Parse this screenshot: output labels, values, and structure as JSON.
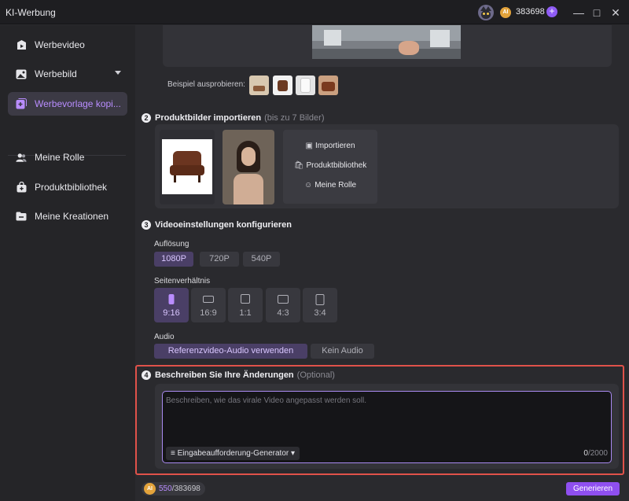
{
  "app": {
    "title": "KI-Werbung",
    "credits": "383698",
    "coin_label": "AI"
  },
  "sidebar": {
    "items": [
      {
        "label": "Werbevideo",
        "icon": "video-icon"
      },
      {
        "label": "Werbebild",
        "icon": "image-icon"
      },
      {
        "label": "Werbevorlage kopi...",
        "icon": "template-copy-icon",
        "active": true
      },
      {
        "label": "Meine Rolle",
        "icon": "user-icon"
      },
      {
        "label": "Produktbibliothek",
        "icon": "bag-icon"
      },
      {
        "label": "Meine Kreationen",
        "icon": "folder-icon"
      }
    ]
  },
  "section1": {
    "try_label": "Beispiel ausprobieren:"
  },
  "section2": {
    "number": "2",
    "title": "Produktbilder importieren",
    "hint": "(bis zu 7 Bilder)",
    "actions": [
      "Importieren",
      "Produktbibliothek",
      "Meine Rolle"
    ]
  },
  "section3": {
    "number": "3",
    "title": "Videoeinstellungen konfigurieren",
    "resolution_label": "Auflösung",
    "resolutions": [
      "1080P",
      "720P",
      "540P"
    ],
    "ratio_label": "Seitenverhältnis",
    "ratios": [
      "9:16",
      "16:9",
      "1:1",
      "4:3",
      "3:4"
    ],
    "audio_label": "Audio",
    "audio_options": [
      "Referenzvideo-Audio verwenden",
      "Kein Audio"
    ]
  },
  "section4": {
    "number": "4",
    "title": "Beschreiben Sie Ihre Änderungen",
    "hint": "(Optional)",
    "placeholder": "Beschreiben, wie das virale Video angepasst werden soll.",
    "generator_label": "Eingabeaufforderung-Generator",
    "count": "0",
    "max": "/2000"
  },
  "footer": {
    "cost_used": "550",
    "cost_total": "/383698",
    "generate_label": "Generieren"
  },
  "colors": {
    "accent": "#8f4ff0",
    "active_text": "#b98dff",
    "highlight_border": "#e0524a"
  }
}
